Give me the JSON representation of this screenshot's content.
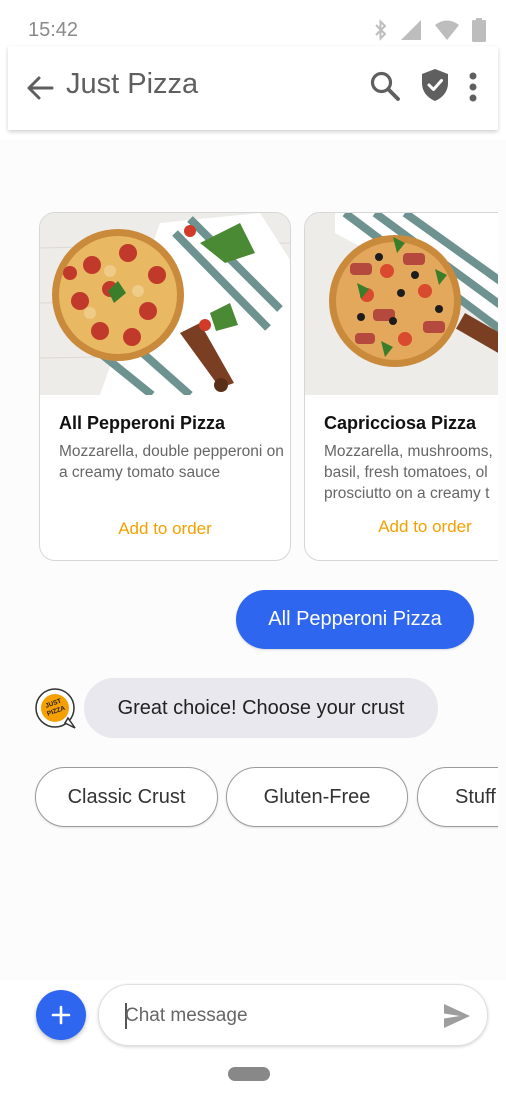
{
  "status_bar": {
    "time": "15:42",
    "icons": [
      "bluetooth-icon",
      "signal-icon",
      "wifi-icon",
      "battery-icon"
    ]
  },
  "app_bar": {
    "title": "Just Pizza",
    "icons": [
      "back-arrow-icon",
      "search-icon",
      "verified-shield-icon",
      "more-vert-icon"
    ]
  },
  "carousel": {
    "cards": [
      {
        "title": "All Pepperoni Pizza",
        "description": "Mozzarella, double pepperoni on a creamy tomato sauce",
        "action": "Add to order"
      },
      {
        "title": "Capricciosa Pizza",
        "description_lines": [
          "Mozzarella, mushrooms,",
          "basil, fresh tomatoes, ol",
          "prosciutto on a creamy t"
        ],
        "action": "Add to order"
      }
    ]
  },
  "messages": {
    "user": "All Pepperoni Pizza",
    "bot": "Great choice! Choose your crust",
    "bot_avatar_text": "JUST PIZZA"
  },
  "suggestions": [
    "Classic Crust",
    "Gluten-Free",
    "Stuff"
  ],
  "compose": {
    "placeholder": "Chat message",
    "add_symbol": "+"
  },
  "colors": {
    "accent": "#2f66f0",
    "action": "#f5a000",
    "bot_bubble": "#e8e8ee"
  }
}
